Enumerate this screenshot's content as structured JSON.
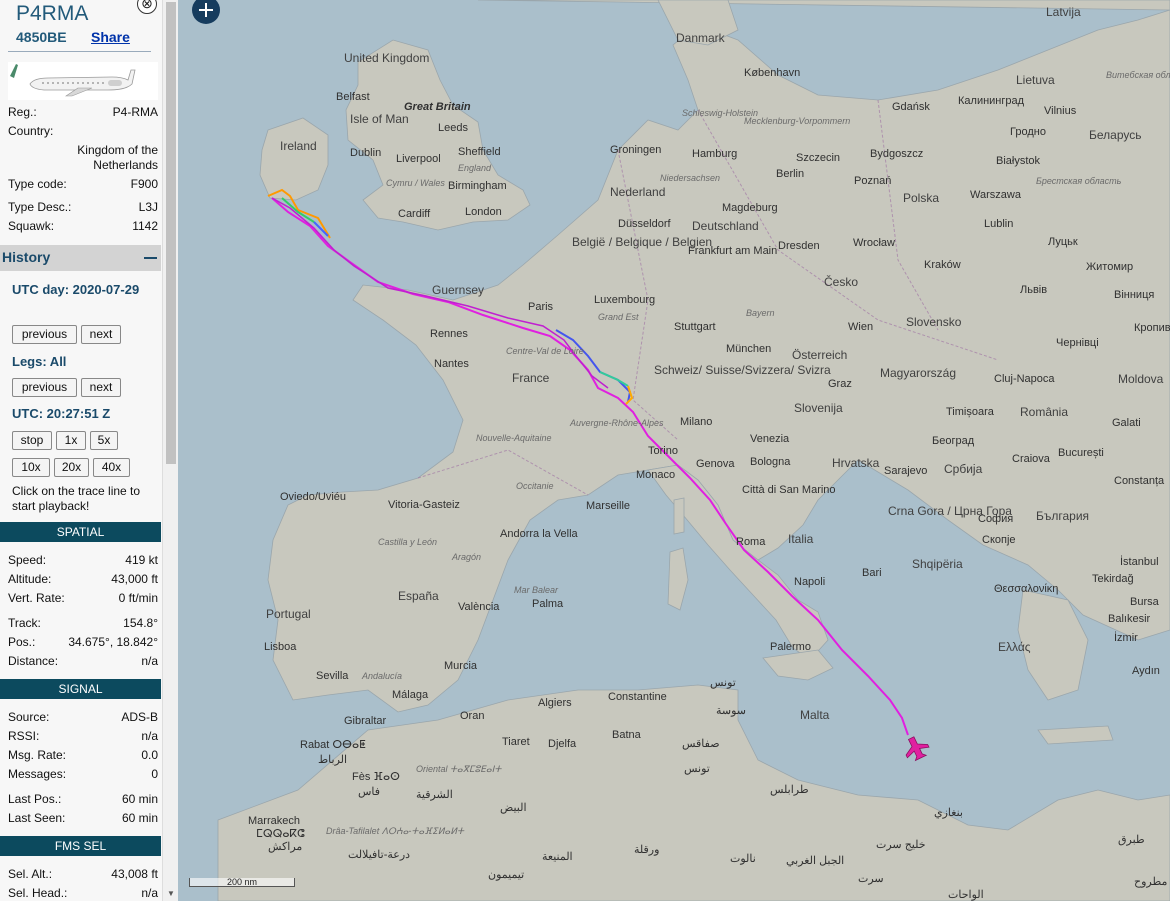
{
  "aircraft": {
    "callsign": "P4RMA",
    "hex": "4850BE",
    "share_label": "Share",
    "close_glyph": "⊗",
    "details": [
      {
        "label": "Reg.:",
        "value": "P4-RMA"
      },
      {
        "label": "Country:",
        "value": ""
      },
      {
        "label": "Type code:",
        "value": "F900"
      },
      {
        "label": "Type Desc.:",
        "value": "L3J"
      },
      {
        "label": "Squawk:",
        "value": "1142"
      }
    ],
    "country_value": "Kingdom of the Netherlands"
  },
  "history": {
    "title": "History",
    "utc_day": "UTC day: 2020-07-29",
    "previous": "previous",
    "next": "next",
    "legs": "Legs: All",
    "utc_time": "UTC: 20:27:51 Z",
    "stop": "stop",
    "speeds": [
      "1x",
      "5x",
      "10x",
      "20x",
      "40x"
    ],
    "note": "Click on the trace line to start playback!"
  },
  "spatial": {
    "title": "SPATIAL",
    "rows": [
      {
        "label": "Speed:",
        "value": "419 kt"
      },
      {
        "label": "Altitude:",
        "value": "43,000 ft"
      },
      {
        "label": "Vert. Rate:",
        "value": "0 ft/min"
      },
      {
        "label": "Track:",
        "value": "154.8°"
      },
      {
        "label": "Pos.:",
        "value": "34.675°, 18.842°"
      },
      {
        "label": "Distance:",
        "value": "n/a"
      }
    ]
  },
  "signal": {
    "title": "SIGNAL",
    "rows": [
      {
        "label": "Source:",
        "value": "ADS-B"
      },
      {
        "label": "RSSI:",
        "value": "n/a"
      },
      {
        "label": "Msg. Rate:",
        "value": "0.0"
      },
      {
        "label": "Messages:",
        "value": "0"
      },
      {
        "label": "Last Pos.:",
        "value": "60 min"
      },
      {
        "label": "Last Seen:",
        "value": "60 min"
      }
    ]
  },
  "fms": {
    "title": "FMS SEL",
    "rows": [
      {
        "label": "Sel. Alt.:",
        "value": "43,008 ft"
      },
      {
        "label": "Sel. Head.:",
        "value": "n/a"
      }
    ]
  },
  "map": {
    "scale_label": "200 nm",
    "track_color": "#e020e0",
    "land_color": "#c8c8be",
    "sea_color": "#aabfcb",
    "labels": {
      "uk": "United Kingdom",
      "great_britain": "Great Britain",
      "ireland": "Ireland",
      "belfast": "Belfast",
      "isle_of_man": "Isle of Man",
      "leeds": "Leeds",
      "dublin": "Dublin",
      "liverpool": "Liverpool",
      "sheffield": "Sheffield",
      "england": "England",
      "cymru": "Cymru / Wales",
      "birmingham": "Birmingham",
      "cardiff": "Cardiff",
      "london": "London",
      "danmark": "Danmark",
      "kobenhavn": "København",
      "latvija": "Latvija",
      "lietuva": "Lietuva",
      "vilnius": "Vilnius",
      "gdansk": "Gdańsk",
      "kaliningrad": "Калининград",
      "grodno": "Гродно",
      "belarus": "Беларусь",
      "bialystok": "Białystok",
      "brest": "Брестская область",
      "vitebsk": "Витебская область",
      "schleswig": "Schleswig-Holstein",
      "mecklenburg": "Mecklenburg-Vorpommern",
      "groningen": "Groningen",
      "hamburg": "Hamburg",
      "szczecin": "Szczecin",
      "bydgoszcz": "Bydgoszcz",
      "niedersachsen": "Niedersachsen",
      "berlin": "Berlin",
      "poznan": "Poznań",
      "nederland": "Nederland",
      "magdeburg": "Magdeburg",
      "polska": "Polska",
      "warszawa": "Warszawa",
      "dusseldorf": "Düsseldorf",
      "deutschland": "Deutschland",
      "lublin": "Lublin",
      "lutsk": "Луцьк",
      "belgie": "België / Belgique / Belgien",
      "frankfurt": "Frankfurt am Main",
      "dresden": "Dresden",
      "wroclaw": "Wrocław",
      "zhytomyr": "Житомир",
      "guernsey": "Guernsey",
      "krakow": "Kraków",
      "lviv": "Львів",
      "vinnytsia": "Вінниця",
      "cesko": "Česko",
      "paris": "Paris",
      "luxembourg": "Luxembourg",
      "bayern": "Bayern",
      "grand_est": "Grand Est",
      "stuttgart": "Stuttgart",
      "wien": "Wien",
      "slovensko": "Slovensko",
      "rennes": "Rennes",
      "munchen": "München",
      "chernivtsi": "Чернівці",
      "kropyvn": "Кропив",
      "osterreich": "Österreich",
      "nantes": "Nantes",
      "centre": "Centre-Val de Loire",
      "france": "France",
      "schweiz": "Schweiz/ Suisse/Svizzera/ Svizra",
      "magyarorszag": "Magyarország",
      "cluj": "Cluj-Napoca",
      "moldova": "Moldova",
      "graz": "Graz",
      "slovenija": "Slovenija",
      "timisoara": "Timișoara",
      "romania": "România",
      "galati": "Galati",
      "milano": "Milano",
      "nouvelle": "Nouvelle-Aquitaine",
      "auvergne": "Auvergne-Rhône-Alpes",
      "venezia": "Venezia",
      "beograd": "Београд",
      "torino": "Torino",
      "genova": "Genova",
      "bologna": "Bologna",
      "hrvatska": "Hrvatska",
      "srbija": "Србија",
      "craiova": "Craiova",
      "bucuresti": "București",
      "monaco": "Monaco",
      "sarajevo": "Sarajevo",
      "occitanie": "Occitanie",
      "citta": "Città di San Marino",
      "constanta": "Constanța",
      "oviedo": "Oviedo/Uviéu",
      "vitoria": "Vitoria-Gasteiz",
      "marseille": "Marseille",
      "crna_gora": "Crna Gora / Црна Гора",
      "sofia": "София",
      "bulgaria": "България",
      "skopje": "Скопје",
      "andorra": "Andorra la Vella",
      "castilla": "Castilla y León",
      "aragon": "Aragón",
      "roma": "Roma",
      "italia": "Italia",
      "istanbul": "İstanbul",
      "tekirdag": "Tekirdağ",
      "espana": "España",
      "valencia": "València",
      "palma": "Palma",
      "mar_balear": "Mar Balear",
      "napoli": "Napoli",
      "bari": "Bari",
      "shqiperia": "Shqipëria",
      "thessaloniki": "Θεσσαλονίκη",
      "bursa": "Bursa",
      "portugal": "Portugal",
      "balikesir": "Balıkesir",
      "lisboa": "Lisboa",
      "palermo": "Palermo",
      "ellas": "Ελλάς",
      "izmir": "İzmir",
      "murcia": "Murcia",
      "aydin": "Aydın",
      "sevilla": "Sevilla",
      "andalucia": "Andalucía",
      "tunis_ar": "تونس",
      "constantine": "Constantine",
      "malaga": "Málaga",
      "algiers": "Algiers",
      "sousse": "سوسة",
      "gibraltar": "Gibraltar",
      "oran": "Oran",
      "malta": "Malta",
      "batna": "Batna",
      "rabat": "Rabat ⵔⴱⴰⵟ",
      "rabat_ar": "الرباط",
      "tiaret": "Tiaret",
      "djelfa": "Djelfa",
      "sfax": "صفاقس",
      "tunis_ar2": "تونس",
      "fes": "Fès ⴼⴰⵙ",
      "fes_ar": "فاس",
      "oriental": "Oriental ⵜⴰⴳⵎⵓⴹⴰⵏⵜ",
      "sharqia": "الشرقية",
      "tripoli": "طرابلس",
      "bayadh": "البيض",
      "benghazi": "بنغازي",
      "marrakech": "Marrakech",
      "marrakech_ber": "ⵎⵕⵕⴰⴽⵛ",
      "marrakech_ar": "مراكش",
      "draa": "Drâa-Tafilalet ⴷⵔⵄⴰ-ⵜⴰⴼⵉⵍⴰⵍⵜ",
      "draa_ar": "درعة-تافيلالت",
      "ouargla": "ورقلة",
      "menia": "المنيعة",
      "timimoun": "تيميمون",
      "tobruk": "طبرق",
      "nalut": "نالوت",
      "jabal": "الجبل الغربي",
      "sirte": "سرت",
      "marzuq": "مطروح",
      "wahat": "الواحات",
      "sirte_gulf": "خليج سرت"
    }
  }
}
